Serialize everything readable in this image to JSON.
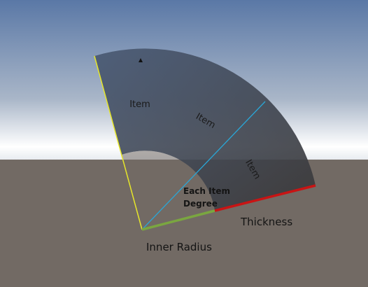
{
  "diagram": {
    "item_labels": [
      "Item",
      "Item",
      "Item"
    ],
    "each_item_degree_lines": [
      "Each Item",
      "Degree"
    ],
    "thickness_label": "Thickness",
    "inner_radius_label": "Inner Radius"
  },
  "colors": {
    "sky_top": "#5a78a6",
    "sky_horizon": "#ffffff",
    "ground": "#726a64",
    "sector_light": "#4a5a74",
    "sector_dark": "#3a3838",
    "inner_radius_line": "#7aa640",
    "thickness_line": "#c81414",
    "start_edge_line": "#e6e62a",
    "divider_line": "#2aa6d6",
    "marker": "#111111"
  },
  "icons": {
    "marker": "triangle-up"
  }
}
